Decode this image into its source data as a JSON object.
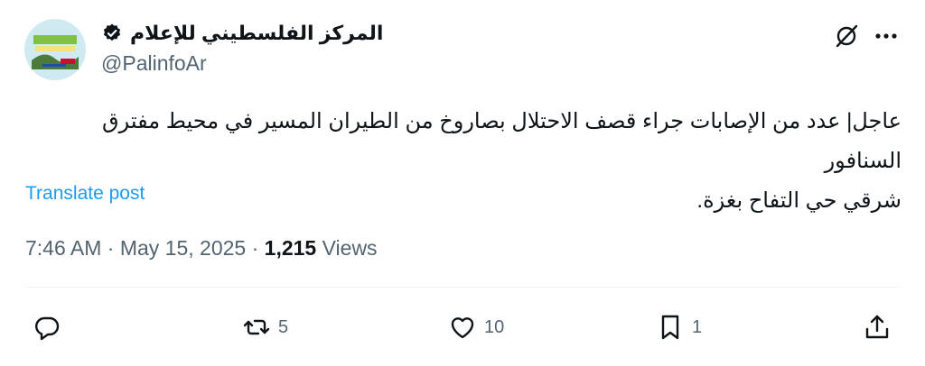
{
  "author": {
    "display_name": "المركز الفلسطيني للإعلام",
    "handle": "@PalinfoAr",
    "verified_icon": "verified-badge-icon"
  },
  "tweet": {
    "text_line1": "عاجل| عدد من الإصابات جراء قصف الاحتلال بصاروخ من الطيران المسير في محيط مفترق السنافور",
    "text_line2": "شرقي حي التفاح بغزة.",
    "translate_label": "Translate post"
  },
  "meta": {
    "time": "7:46 AM",
    "separator": " · ",
    "date": "May 15, 2025",
    "separator2": " · ",
    "views_count": "1,215",
    "views_label": " Views"
  },
  "actions": {
    "replies_icon": "reply-icon",
    "reposts_count": "5",
    "likes_count": "10",
    "bookmarks_count": "1",
    "share_icon": "share-icon"
  },
  "colors": {
    "accent": "#1d9bf0",
    "muted": "#536471",
    "text": "#0f1419"
  }
}
